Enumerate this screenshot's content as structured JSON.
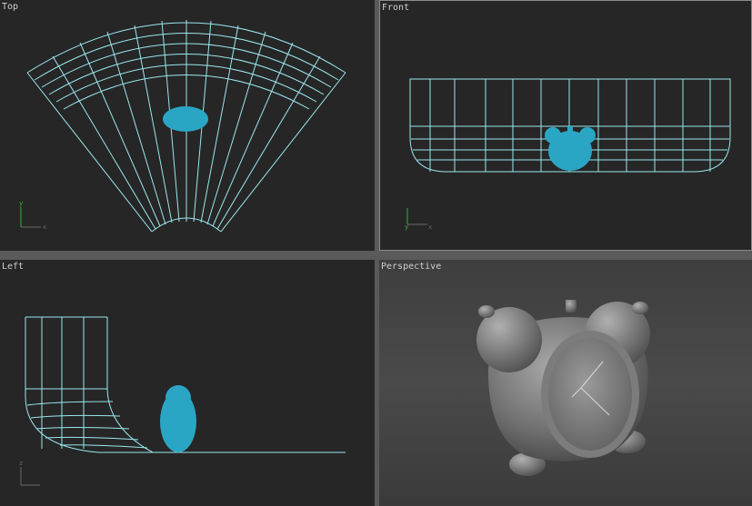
{
  "viewports": {
    "top": {
      "label": "Top"
    },
    "front": {
      "label": "Front"
    },
    "left": {
      "label": "Left"
    },
    "perspective": {
      "label": "Perspective"
    }
  },
  "axes": {
    "y": "y",
    "x": "x",
    "z": "z"
  },
  "colors": {
    "wireframe": "#9be7ee",
    "selected_object": "#2aa6c4",
    "viewport_bg": "#262626",
    "active_border": "#8a8a8a"
  },
  "icons": {
    "axis_tripod": "axis-tripod-icon"
  }
}
